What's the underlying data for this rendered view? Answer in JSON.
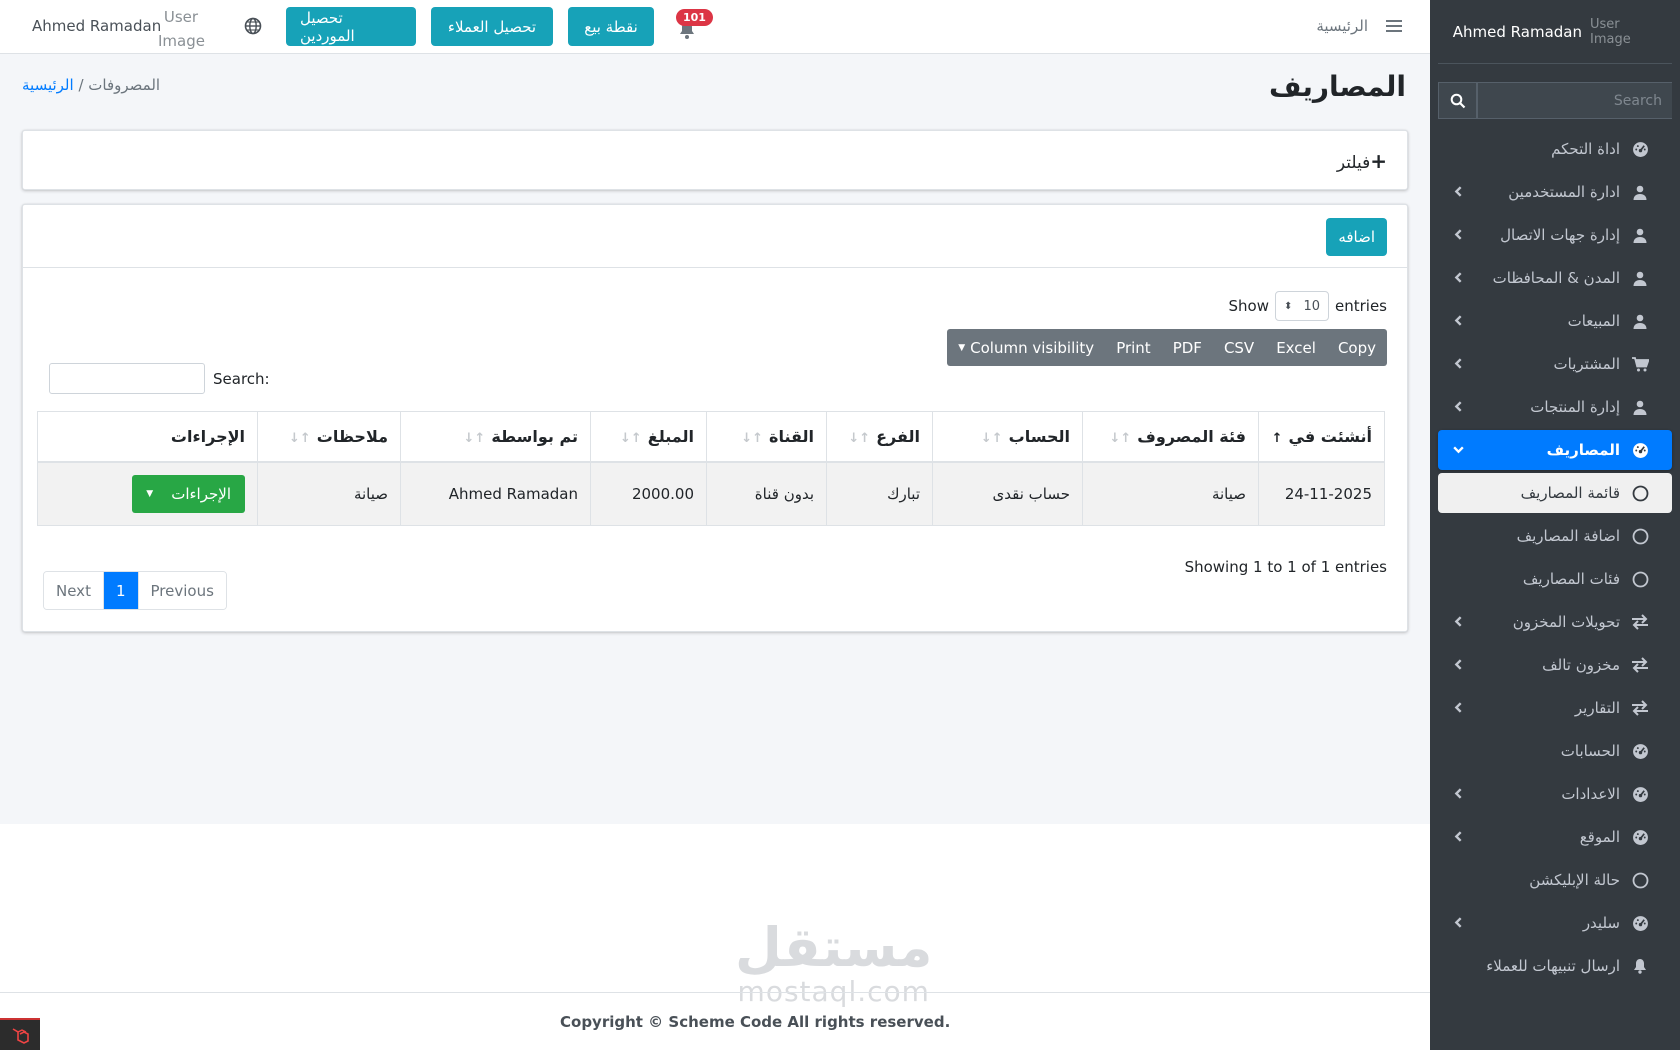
{
  "sidebar": {
    "user_name": "Ahmed Ramadan",
    "user_image_alt": "User Image",
    "search_placeholder": "Search",
    "items": [
      {
        "label": "اداة التحكم",
        "icon": "dashboard-icon"
      },
      {
        "label": "ادارة المستخدمين",
        "icon": "user-icon"
      },
      {
        "label": "إدارة جهات الاتصال",
        "icon": "user-icon"
      },
      {
        "label": "المدن & المحافظات",
        "icon": "user-icon"
      },
      {
        "label": "المبيعات",
        "icon": "user-icon"
      },
      {
        "label": "المشتريات",
        "icon": "cart-icon"
      },
      {
        "label": "إدارة المنتجات",
        "icon": "user-icon"
      },
      {
        "label": "المصاريف",
        "icon": "dashboard-icon"
      },
      {
        "label": "قائمة المصاريف",
        "icon": "circle-icon"
      },
      {
        "label": "اضافة المصاريف",
        "icon": "circle-icon"
      },
      {
        "label": "فئات المصاريف",
        "icon": "circle-icon"
      },
      {
        "label": "تحويلات المخزون",
        "icon": "exchange-icon"
      },
      {
        "label": "مخزون تالف",
        "icon": "exchange-icon"
      },
      {
        "label": "التقارير",
        "icon": "exchange-icon"
      },
      {
        "label": "الحسابات",
        "icon": "dashboard-icon"
      },
      {
        "label": "الاعدادات",
        "icon": "dashboard-icon"
      },
      {
        "label": "الموقع",
        "icon": "dashboard-icon"
      },
      {
        "label": "حالة الإبليكشن",
        "icon": "circle-icon"
      },
      {
        "label": "سليدر",
        "icon": "dashboard-icon"
      },
      {
        "label": "ارسال تنبيهات للعملاء",
        "icon": "bell-icon"
      }
    ]
  },
  "navbar": {
    "home_link": "الرئيسية",
    "notification_count": "101",
    "pos_button": "نقطة بيع",
    "customers_button": "تحصيل العملاء",
    "suppliers_button": "تحصيل الموردين",
    "user_image_alt": "User Image",
    "user_name": "Ahmed Ramadan"
  },
  "page": {
    "title": "المصاريف",
    "breadcrumb_home": "الرئيسية",
    "breadcrumb_sep": " / ",
    "breadcrumb_current": "المصروفات",
    "filter_label": "فيلتر"
  },
  "table_card": {
    "add_button": "اضافه",
    "show_label": "Show",
    "entries_label": "entries",
    "page_length": "10",
    "export_buttons": [
      "Copy",
      "Excel",
      "CSV",
      "PDF",
      "Print",
      "Column visibility"
    ],
    "search_label": "Search:",
    "columns": [
      "أنشئت في",
      "فئة المصروف",
      "الحساب",
      "الفرع",
      "القناة",
      "المبلغ",
      "تم بواسطة",
      "ملاحظات",
      "الإجراءات"
    ],
    "rows": [
      {
        "created": "24-11-2025",
        "category": "صيانة",
        "account": "حساب نقدى",
        "branch": "تبارك",
        "channel": "بدون قناة",
        "amount": "2000.00",
        "by": "Ahmed Ramadan",
        "notes": "صيانة",
        "action": "الإجراءات"
      }
    ],
    "info": "Showing 1 to 1 of 1 entries",
    "pagination": {
      "previous": "Previous",
      "current": "1",
      "next": "Next"
    }
  },
  "footer": {
    "copyright": "Copyright © Scheme Code All rights reserved.",
    "watermark_ar": "مستقل",
    "watermark_en": "mostaql.com"
  },
  "colors": {
    "sidebar_bg": "#343a40",
    "primary": "#007bff",
    "info": "#17a2b8",
    "success": "#28a745",
    "danger": "#dc3545",
    "secondary": "#6c757d"
  }
}
